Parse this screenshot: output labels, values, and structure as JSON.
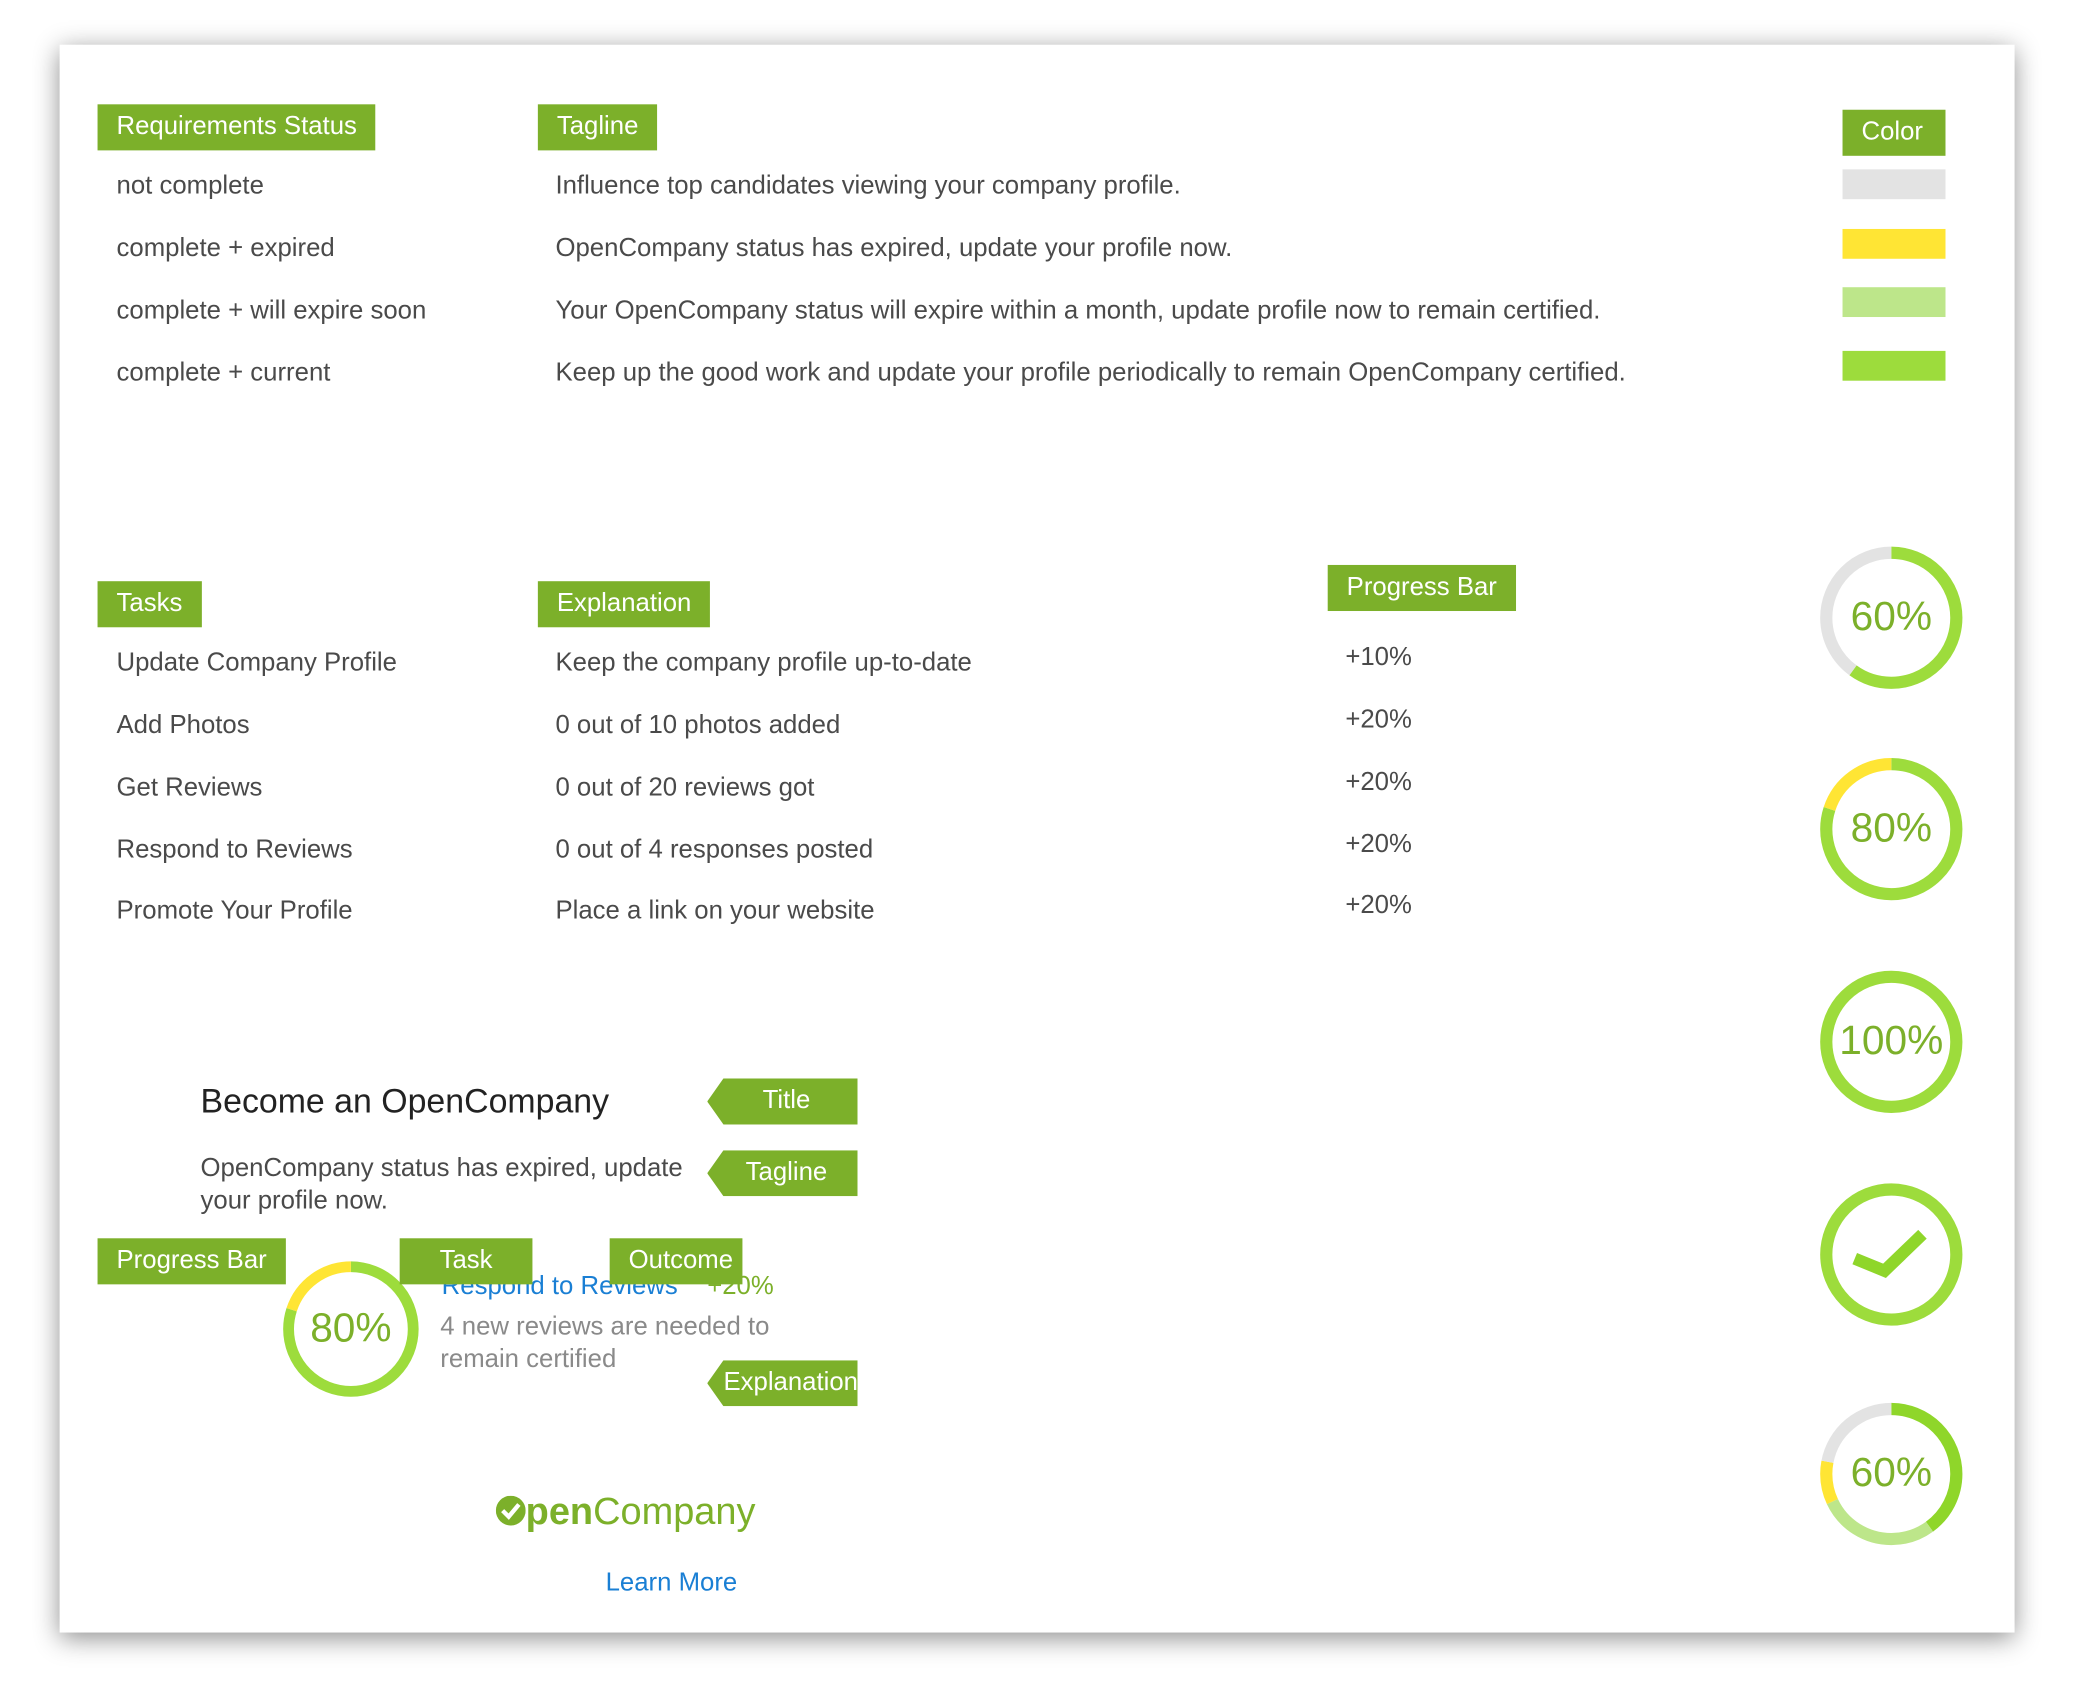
{
  "requirements": {
    "header_status": "Requirements Status",
    "header_tagline": "Tagline",
    "header_color": "Color",
    "rows": [
      {
        "status": "not complete",
        "tagline": "Influence top candidates viewing your company profile.",
        "color": "#e3e3e3"
      },
      {
        "status": "complete + expired",
        "tagline": "OpenCompany status has expired, update your profile now.",
        "color": "#ffe534"
      },
      {
        "status": "complete + will expire soon",
        "tagline": "Your OpenCompany status will expire within a month, update profile now to remain certified.",
        "color": "#bde68a"
      },
      {
        "status": "complete + current",
        "tagline": "Keep up the good work and update your profile periodically to remain OpenCompany certified.",
        "color": "#9ddc3c"
      }
    ]
  },
  "tasks": {
    "header_tasks": "Tasks",
    "header_explanation": "Explanation",
    "header_progress": "Progress Bar",
    "rows": [
      {
        "task": "Update Company Profile",
        "explanation": "Keep the company profile up-to-date",
        "progress": "+10%"
      },
      {
        "task": "Add Photos",
        "explanation": "0 out of 10 photos added",
        "progress": "+20%"
      },
      {
        "task": "Get Reviews",
        "explanation": "0 out of 20 reviews got",
        "progress": "+20%"
      },
      {
        "task": "Respond to Reviews",
        "explanation": "0 out of 4 responses posted",
        "progress": "+20%"
      },
      {
        "task": "Promote Your Profile",
        "explanation": "Place a link on your website",
        "progress": "+20%"
      }
    ]
  },
  "rings": [
    {
      "label": "60%",
      "segments": [
        {
          "frac": 0.6,
          "color": "#9ddc3c"
        },
        {
          "frac": 0.4,
          "color": "#e3e3e3"
        }
      ]
    },
    {
      "label": "80%",
      "segments": [
        {
          "frac": 0.8,
          "color": "#9ddc3c"
        },
        {
          "frac": 0.2,
          "color": "#ffe534"
        }
      ]
    },
    {
      "label": "100%",
      "segments": [
        {
          "frac": 1.0,
          "color": "#9ddc3c"
        }
      ]
    },
    {
      "label": "",
      "icon": "checkmark-icon",
      "segments": [
        {
          "frac": 1.0,
          "color": "#9ddc3c"
        }
      ]
    },
    {
      "label": "60%",
      "segments": [
        {
          "frac": 0.4,
          "color": "#8fd62a"
        },
        {
          "frac": 0.28,
          "color": "#bde68a"
        },
        {
          "frac": 0.1,
          "color": "#ffe534"
        },
        {
          "frac": 0.22,
          "color": "#e3e3e3"
        }
      ]
    }
  ],
  "widget": {
    "title": "Become an OpenCompany",
    "tagline_line1": "OpenCompany status has expired, update",
    "tagline_line2": "your profile now.",
    "progress_label": "80%",
    "progress_segments": [
      {
        "frac": 0.8,
        "color": "#9ddc3c"
      },
      {
        "frac": 0.2,
        "color": "#ffe534"
      }
    ],
    "task": "Respond to Reviews",
    "outcome": "+20%",
    "explanation_line1": "4 new reviews are needed to",
    "explanation_line2": "remain certified",
    "logo_bold": "pen",
    "logo_light": "Company",
    "learn_more": "Learn More"
  },
  "annotations": {
    "title": "Title",
    "tagline": "Tagline",
    "explanation": "Explanation",
    "progress_bar": "Progress Bar",
    "task": "Task",
    "outcome": "Outcome"
  },
  "colors": {
    "accent": "#7cb02a",
    "link": "#1a7fd4"
  }
}
